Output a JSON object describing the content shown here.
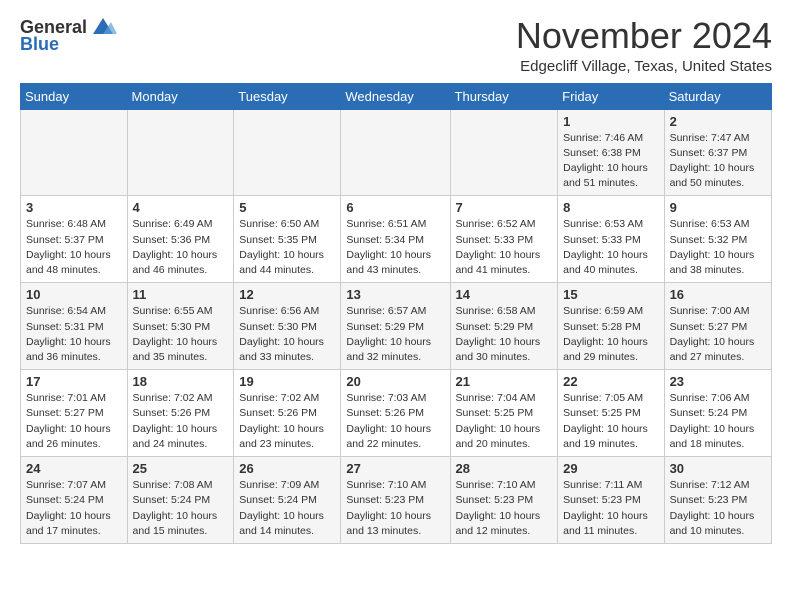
{
  "header": {
    "logo_general": "General",
    "logo_blue": "Blue",
    "month": "November 2024",
    "location": "Edgecliff Village, Texas, United States"
  },
  "days_of_week": [
    "Sunday",
    "Monday",
    "Tuesday",
    "Wednesday",
    "Thursday",
    "Friday",
    "Saturday"
  ],
  "weeks": [
    [
      {
        "day": "",
        "info": ""
      },
      {
        "day": "",
        "info": ""
      },
      {
        "day": "",
        "info": ""
      },
      {
        "day": "",
        "info": ""
      },
      {
        "day": "",
        "info": ""
      },
      {
        "day": "1",
        "info": "Sunrise: 7:46 AM\nSunset: 6:38 PM\nDaylight: 10 hours and 51 minutes."
      },
      {
        "day": "2",
        "info": "Sunrise: 7:47 AM\nSunset: 6:37 PM\nDaylight: 10 hours and 50 minutes."
      }
    ],
    [
      {
        "day": "3",
        "info": "Sunrise: 6:48 AM\nSunset: 5:37 PM\nDaylight: 10 hours and 48 minutes."
      },
      {
        "day": "4",
        "info": "Sunrise: 6:49 AM\nSunset: 5:36 PM\nDaylight: 10 hours and 46 minutes."
      },
      {
        "day": "5",
        "info": "Sunrise: 6:50 AM\nSunset: 5:35 PM\nDaylight: 10 hours and 44 minutes."
      },
      {
        "day": "6",
        "info": "Sunrise: 6:51 AM\nSunset: 5:34 PM\nDaylight: 10 hours and 43 minutes."
      },
      {
        "day": "7",
        "info": "Sunrise: 6:52 AM\nSunset: 5:33 PM\nDaylight: 10 hours and 41 minutes."
      },
      {
        "day": "8",
        "info": "Sunrise: 6:53 AM\nSunset: 5:33 PM\nDaylight: 10 hours and 40 minutes."
      },
      {
        "day": "9",
        "info": "Sunrise: 6:53 AM\nSunset: 5:32 PM\nDaylight: 10 hours and 38 minutes."
      }
    ],
    [
      {
        "day": "10",
        "info": "Sunrise: 6:54 AM\nSunset: 5:31 PM\nDaylight: 10 hours and 36 minutes."
      },
      {
        "day": "11",
        "info": "Sunrise: 6:55 AM\nSunset: 5:30 PM\nDaylight: 10 hours and 35 minutes."
      },
      {
        "day": "12",
        "info": "Sunrise: 6:56 AM\nSunset: 5:30 PM\nDaylight: 10 hours and 33 minutes."
      },
      {
        "day": "13",
        "info": "Sunrise: 6:57 AM\nSunset: 5:29 PM\nDaylight: 10 hours and 32 minutes."
      },
      {
        "day": "14",
        "info": "Sunrise: 6:58 AM\nSunset: 5:29 PM\nDaylight: 10 hours and 30 minutes."
      },
      {
        "day": "15",
        "info": "Sunrise: 6:59 AM\nSunset: 5:28 PM\nDaylight: 10 hours and 29 minutes."
      },
      {
        "day": "16",
        "info": "Sunrise: 7:00 AM\nSunset: 5:27 PM\nDaylight: 10 hours and 27 minutes."
      }
    ],
    [
      {
        "day": "17",
        "info": "Sunrise: 7:01 AM\nSunset: 5:27 PM\nDaylight: 10 hours and 26 minutes."
      },
      {
        "day": "18",
        "info": "Sunrise: 7:02 AM\nSunset: 5:26 PM\nDaylight: 10 hours and 24 minutes."
      },
      {
        "day": "19",
        "info": "Sunrise: 7:02 AM\nSunset: 5:26 PM\nDaylight: 10 hours and 23 minutes."
      },
      {
        "day": "20",
        "info": "Sunrise: 7:03 AM\nSunset: 5:26 PM\nDaylight: 10 hours and 22 minutes."
      },
      {
        "day": "21",
        "info": "Sunrise: 7:04 AM\nSunset: 5:25 PM\nDaylight: 10 hours and 20 minutes."
      },
      {
        "day": "22",
        "info": "Sunrise: 7:05 AM\nSunset: 5:25 PM\nDaylight: 10 hours and 19 minutes."
      },
      {
        "day": "23",
        "info": "Sunrise: 7:06 AM\nSunset: 5:24 PM\nDaylight: 10 hours and 18 minutes."
      }
    ],
    [
      {
        "day": "24",
        "info": "Sunrise: 7:07 AM\nSunset: 5:24 PM\nDaylight: 10 hours and 17 minutes."
      },
      {
        "day": "25",
        "info": "Sunrise: 7:08 AM\nSunset: 5:24 PM\nDaylight: 10 hours and 15 minutes."
      },
      {
        "day": "26",
        "info": "Sunrise: 7:09 AM\nSunset: 5:24 PM\nDaylight: 10 hours and 14 minutes."
      },
      {
        "day": "27",
        "info": "Sunrise: 7:10 AM\nSunset: 5:23 PM\nDaylight: 10 hours and 13 minutes."
      },
      {
        "day": "28",
        "info": "Sunrise: 7:10 AM\nSunset: 5:23 PM\nDaylight: 10 hours and 12 minutes."
      },
      {
        "day": "29",
        "info": "Sunrise: 7:11 AM\nSunset: 5:23 PM\nDaylight: 10 hours and 11 minutes."
      },
      {
        "day": "30",
        "info": "Sunrise: 7:12 AM\nSunset: 5:23 PM\nDaylight: 10 hours and 10 minutes."
      }
    ]
  ]
}
